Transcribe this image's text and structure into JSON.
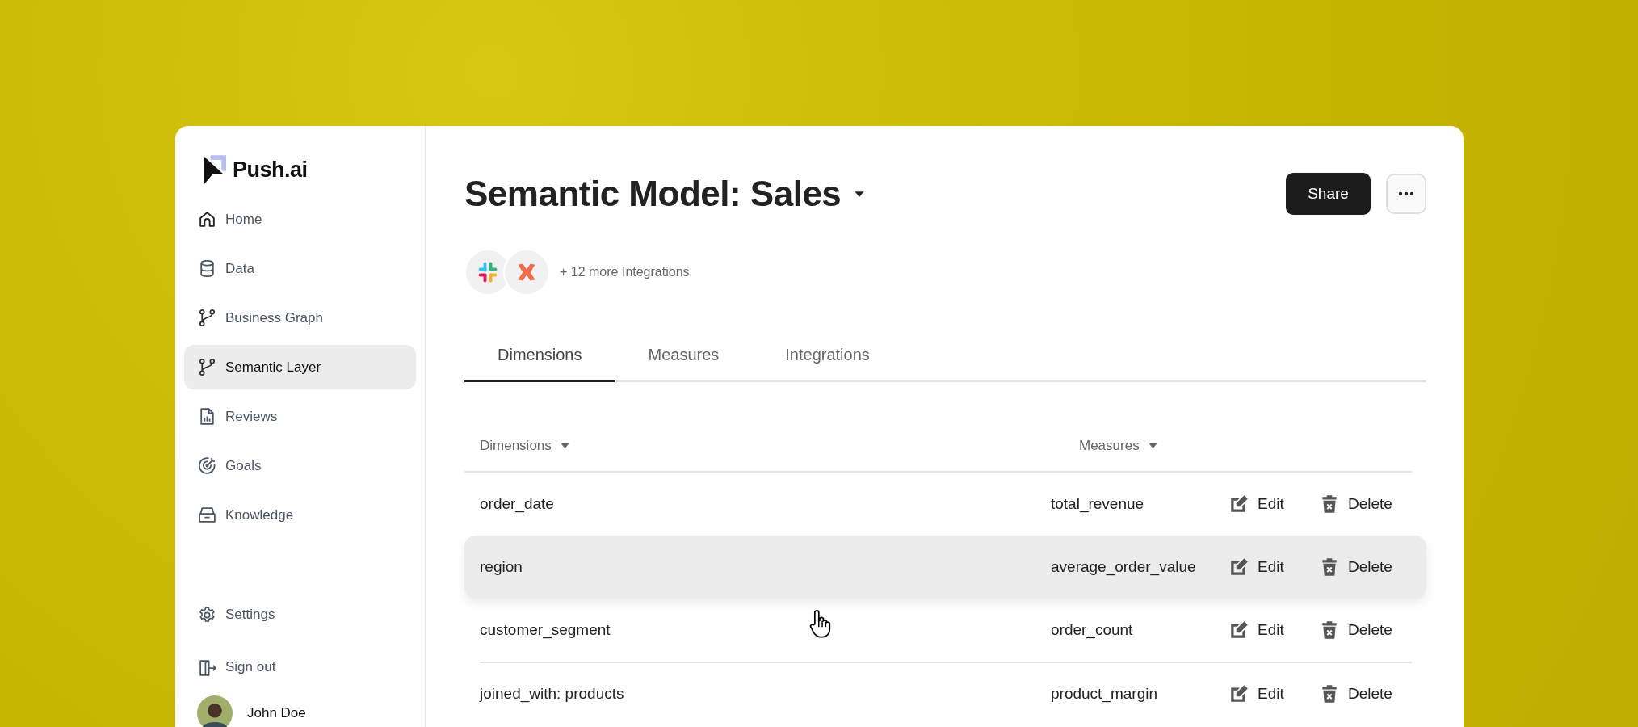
{
  "app": {
    "logo": "Push.ai"
  },
  "sidebar": {
    "items": [
      {
        "label": "Home",
        "kind": "home",
        "selected": false
      },
      {
        "label": "Data",
        "kind": "database",
        "selected": false
      },
      {
        "label": "Business Graph",
        "kind": "branch",
        "selected": false
      },
      {
        "label": "Semantic Layer",
        "kind": "branch",
        "selected": true
      },
      {
        "label": "Reviews",
        "kind": "report",
        "selected": false
      },
      {
        "label": "Goals",
        "kind": "target",
        "selected": false
      },
      {
        "label": "Knowledge",
        "kind": "tray",
        "selected": false
      }
    ],
    "footer_items": [
      {
        "label": "Settings",
        "kind": "settings"
      },
      {
        "label": "Sign out",
        "kind": "signout"
      }
    ],
    "user": {
      "name": "John Doe"
    }
  },
  "header": {
    "title": "Semantic Model: Sales",
    "share": "Share",
    "integrations": [
      {
        "kind": "hash"
      },
      {
        "kind": "cross"
      }
    ],
    "integrations_more": "+ 12 more Integrations"
  },
  "tabs": [
    {
      "label": "Dimensions",
      "selected": true
    },
    {
      "label": "Measures",
      "selected": false
    },
    {
      "label": "Integrations",
      "selected": false
    }
  ],
  "table": {
    "columns": [
      "Dimensions",
      "Measures"
    ],
    "rows": [
      {
        "dimension": "order_date",
        "measure": "total_revenue",
        "edit": "Edit",
        "delete": "Delete",
        "selected": false
      },
      {
        "dimension": "region",
        "measure": "average_order_value",
        "edit": "Edit",
        "delete": "Delete",
        "selected": true
      },
      {
        "dimension": "customer_segment",
        "measure": "order_count",
        "edit": "Edit",
        "delete": "Delete",
        "selected": false
      },
      {
        "dimension": "joined_with: products",
        "measure": "product_margin",
        "edit": "Edit",
        "delete": "Delete",
        "selected": false
      }
    ]
  }
}
